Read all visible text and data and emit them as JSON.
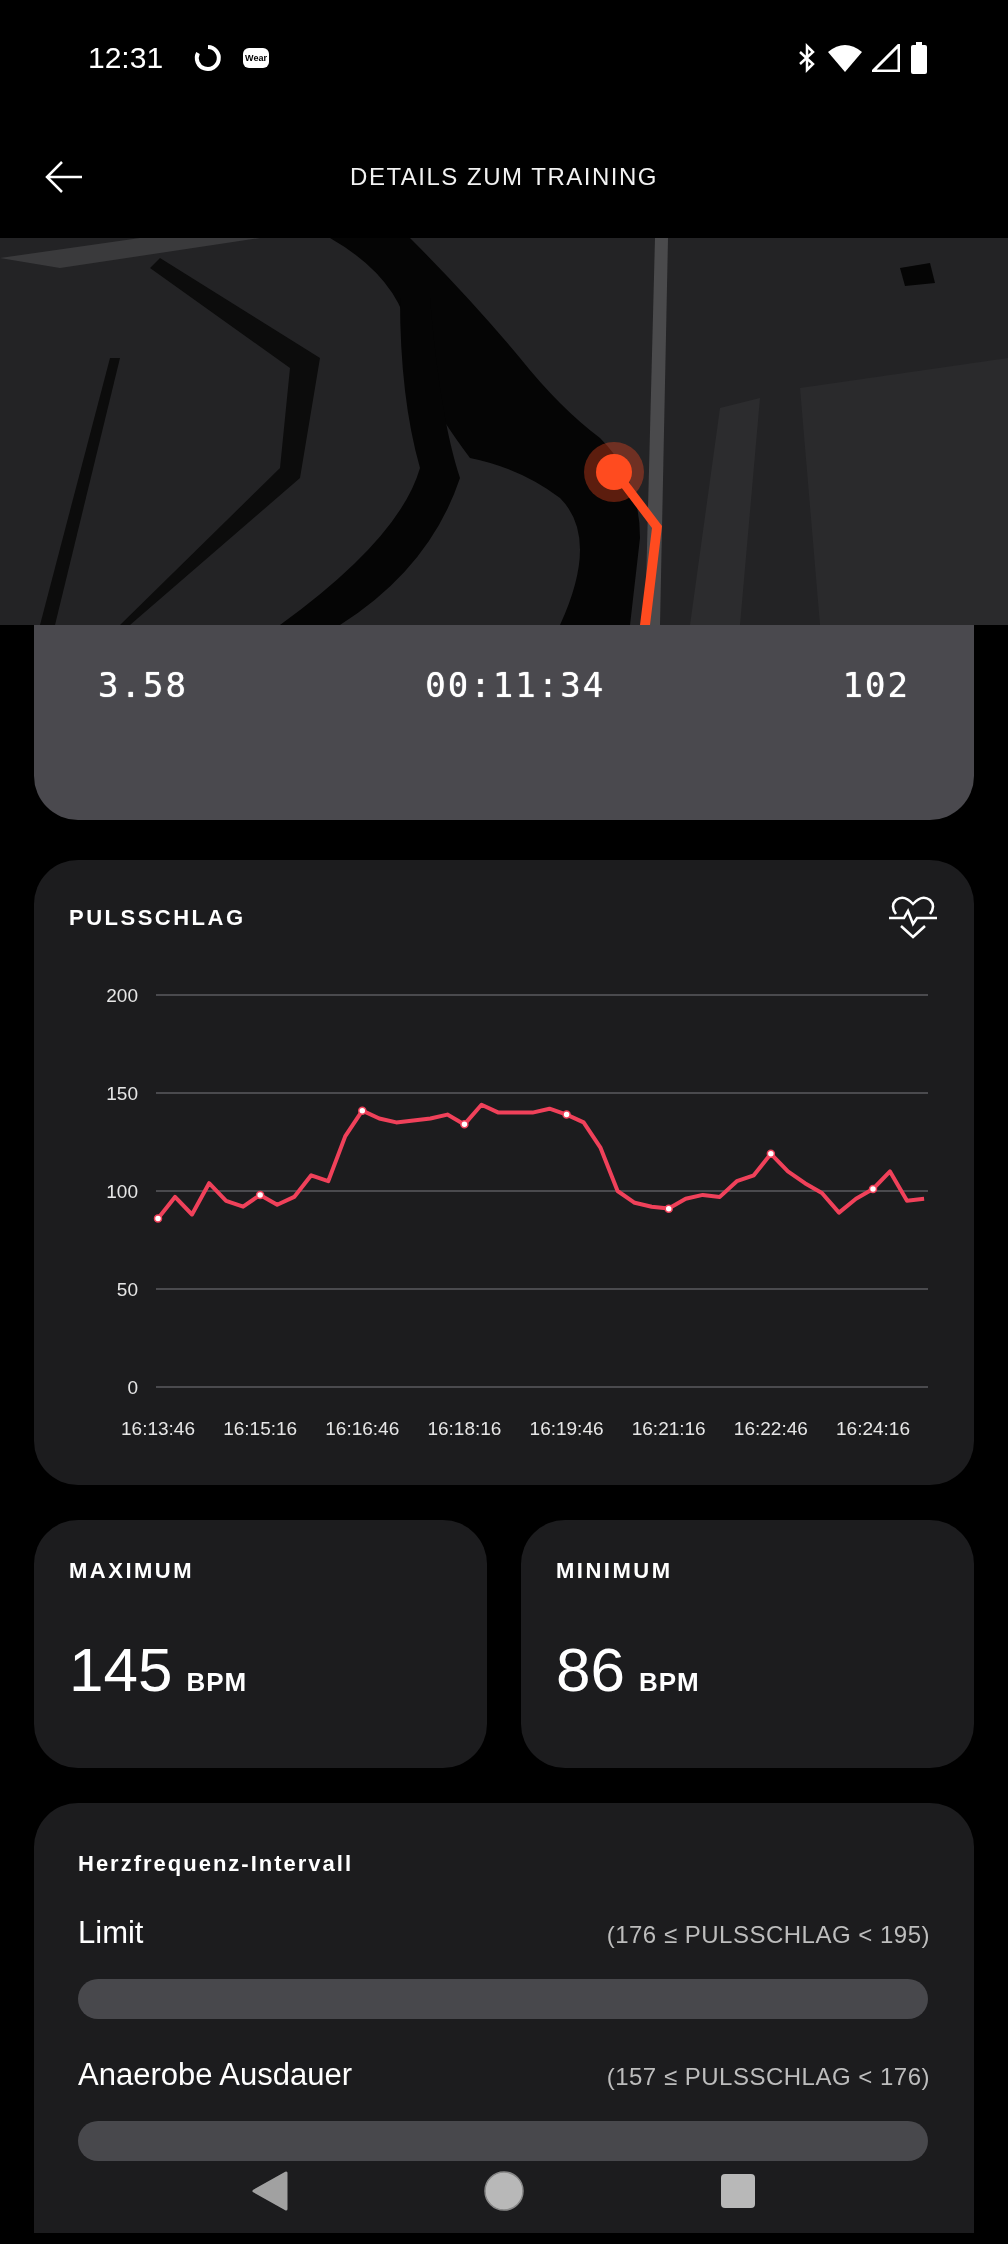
{
  "status_bar": {
    "time": "12:31",
    "wear_badge": "Wear"
  },
  "app_bar": {
    "title": "DETAILS ZUM TRAINING"
  },
  "summary": {
    "values": [
      "3.58",
      "00:11:34",
      "102"
    ]
  },
  "heart_rate": {
    "title": "PULSSCHLAG",
    "chart_data": {
      "type": "line",
      "categories": [
        "16:13:46",
        null,
        null,
        null,
        null,
        null,
        "16:15:16",
        null,
        null,
        null,
        null,
        null,
        "16:16:46",
        null,
        null,
        null,
        null,
        null,
        "16:18:16",
        null,
        null,
        null,
        null,
        null,
        "16:19:46",
        null,
        null,
        null,
        null,
        null,
        "16:21:16",
        null,
        null,
        null,
        null,
        null,
        "16:22:46",
        null,
        null,
        null,
        null,
        null,
        "16:24:16",
        null,
        null,
        null
      ],
      "series": [
        {
          "color": "#f0415a",
          "values": [
            86,
            97,
            88,
            104,
            95,
            92,
            98,
            93,
            97,
            108,
            105,
            128,
            141,
            137,
            135,
            136,
            137,
            139,
            134,
            144,
            140,
            140,
            140,
            142,
            139,
            135,
            122,
            100,
            94,
            92,
            91,
            96,
            98,
            97,
            105,
            108,
            119,
            110,
            104,
            99,
            89,
            96,
            101,
            110,
            95,
            96
          ]
        }
      ],
      "ylim": [
        0,
        200
      ],
      "yticks": [
        0,
        50,
        100,
        150,
        200
      ],
      "grid": true
    }
  },
  "extremes": [
    {
      "label": "MAXIMUM",
      "value": "145",
      "unit": "BPM"
    },
    {
      "label": "MINIMUM",
      "value": "86",
      "unit": "BPM"
    }
  ],
  "intervals": {
    "title": "Herzfrequenz-Intervall",
    "zones": [
      {
        "name": "Limit",
        "range": "(176 ≤ PULSSCHLAG < 195)",
        "level": 0
      },
      {
        "name": "Anaerobe Ausdauer",
        "range": "(157 ≤ PULSSCHLAG < 176)",
        "level": 0
      }
    ]
  }
}
